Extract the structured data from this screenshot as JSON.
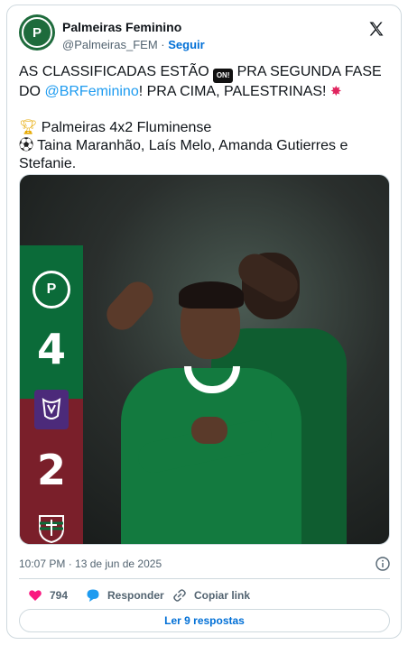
{
  "author": {
    "name": "Palmeiras Feminino",
    "handle": "@Palmeiras_FEM",
    "separator": "·",
    "follow_label": "Seguir"
  },
  "tweet": {
    "line1_a": "AS CLASSIFICADAS ESTÃO ",
    "line1_b": " PRA SEGUNDA FASE DO ",
    "mention": "@BRFeminino",
    "line1_c": "! PRA CIMA, PALESTRINAS! ",
    "on_emoji_text": "ON!",
    "result": "Palmeiras 4x2 Fluminense",
    "scorers": "Taina Maranhão, Laís Melo, Amanda Gutierres e Stefanie."
  },
  "media": {
    "home_score": "4",
    "away_score": "2",
    "home_crest_text": "P",
    "colors": {
      "home_green": "#0b6b39",
      "away_maroon": "#7a1f2a",
      "league_purple": "#4c2a7a"
    }
  },
  "meta": {
    "timestamp": "10:07 PM · 13 de jun de 2025"
  },
  "actions": {
    "like_count": "794",
    "reply_label": "Responder",
    "copy_label": "Copiar link"
  },
  "replies_button": "Ler 9 respostas",
  "icons": [
    "x-logo-icon",
    "heart-icon",
    "reply-bubble-icon",
    "link-icon",
    "info-icon",
    "trophy-icon",
    "soccer-ball-icon",
    "collision-icon"
  ]
}
